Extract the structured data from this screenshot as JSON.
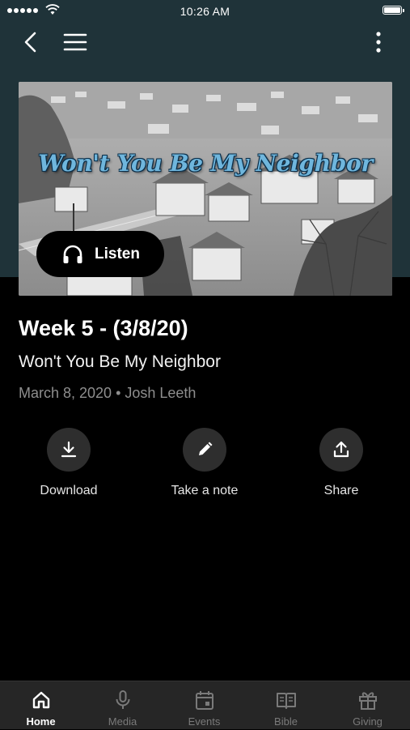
{
  "status_bar": {
    "time": "10:26 AM"
  },
  "hero": {
    "title": "Won't You Be My Neighbor",
    "listen_label": "Listen"
  },
  "sermon": {
    "title": "Week 5 - (3/8/20)",
    "series": "Won't You Be My Neighbor",
    "meta": "March 8, 2020 • Josh Leeth"
  },
  "actions": [
    {
      "label": "Download",
      "icon": "download-icon"
    },
    {
      "label": "Take a note",
      "icon": "pencil-icon"
    },
    {
      "label": "Share",
      "icon": "share-icon"
    }
  ],
  "tabs": [
    {
      "label": "Home",
      "icon": "home-icon",
      "active": true
    },
    {
      "label": "Media",
      "icon": "microphone-icon",
      "active": false
    },
    {
      "label": "Events",
      "icon": "calendar-icon",
      "active": false
    },
    {
      "label": "Bible",
      "icon": "book-icon",
      "active": false
    },
    {
      "label": "Giving",
      "icon": "gift-icon",
      "active": false
    }
  ],
  "colors": {
    "header_background": "#1f3339",
    "page_background": "#000000",
    "tab_bar_background": "#262626",
    "hero_title": "#6fb6dd"
  }
}
